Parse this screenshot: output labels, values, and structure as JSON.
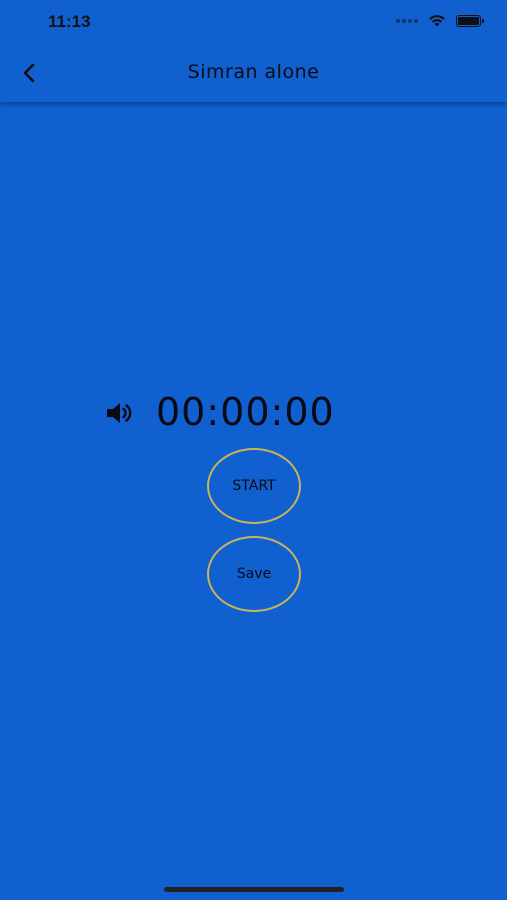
{
  "status_bar": {
    "time": "11:13"
  },
  "header": {
    "title": "Simran alone",
    "back_icon": "chevron-left-icon"
  },
  "timer": {
    "display": "00:00:00",
    "sound_icon": "speaker-icon"
  },
  "actions": {
    "start_label": "START",
    "save_label": "Save"
  },
  "colors": {
    "background": "#1060D0",
    "button_border": "#C9B25A"
  }
}
